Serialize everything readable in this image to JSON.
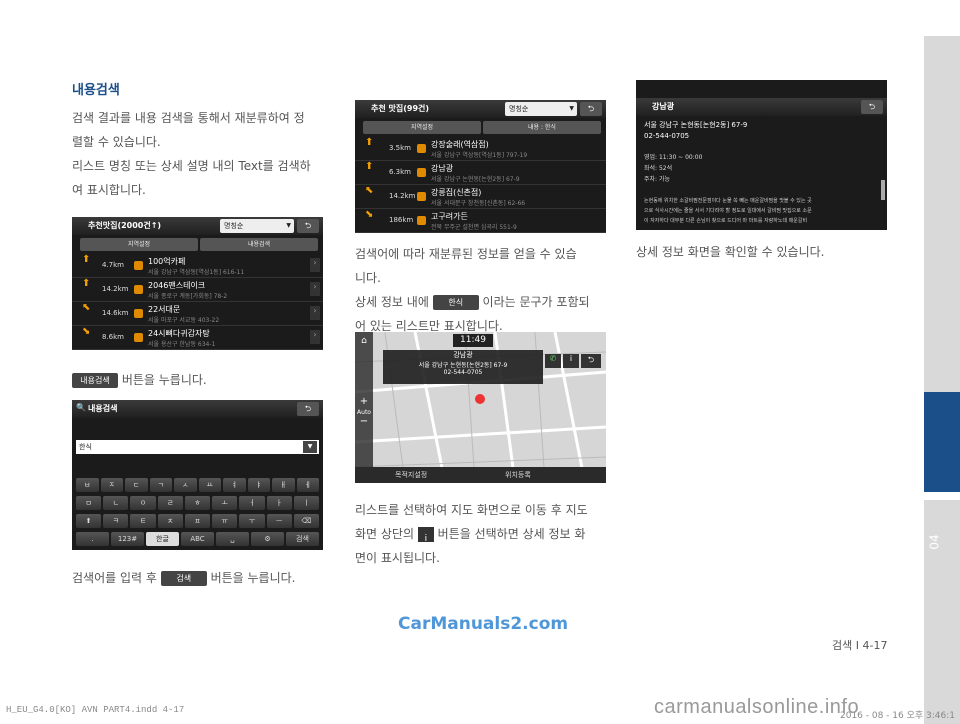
{
  "heading": "내용검색",
  "intro": [
    "검색 결과를 내용 검색을 통해서 재분류하여 정",
    "렬할 수 있습니다.",
    "리스트 명칭 또는 상세 설명 내의 Text를 검색하",
    "여 표시합니다."
  ],
  "shot1": {
    "title": "추천맛집(2000건↑)",
    "sort": "명칭순",
    "btn_area": "지역설정",
    "btn_search": "내용검색",
    "rows": [
      {
        "dist": "4.7km",
        "name": "100억카페",
        "addr": "서울 강남구 역삼동[역삼1동] 616-11"
      },
      {
        "dist": "14.2km",
        "name": "2046팬스테이크",
        "addr": "서울 종로구 계동[가회동] 78-2"
      },
      {
        "dist": "14.6km",
        "name": "22서대문",
        "addr": "서울 마포구 서교동 403-22"
      },
      {
        "dist": "8.6km",
        "name": "24시뼈다귀감자탕",
        "addr": "서울 용산구 한남동 634-1"
      }
    ]
  },
  "step1": {
    "button": "내용검색",
    "text": "버튼을 누릅니다."
  },
  "shot2": {
    "title": "내용검색",
    "input": "한식",
    "keys_row1": [
      "ㅂ",
      "ㅈ",
      "ㄷ",
      "ㄱ",
      "ㅅ",
      "ㅛ",
      "ㅕ",
      "ㅑ",
      "ㅐ",
      "ㅔ"
    ],
    "keys_row2": [
      "ㅁ",
      "ㄴ",
      "ㅇ",
      "ㄹ",
      "ㅎ",
      "ㅗ",
      "ㅓ",
      "ㅏ",
      "ㅣ"
    ],
    "keys_row3": [
      "⬆",
      "ㅋ",
      "ㅌ",
      "ㅊ",
      "ㅍ",
      "ㅠ",
      "ㅜ",
      "ㅡ",
      "⌫"
    ],
    "keys_row4": [
      ".",
      "123#",
      "한글",
      "ABC",
      "␣",
      "⚙",
      "검색"
    ]
  },
  "step2": {
    "pre": "검색어를 입력 후",
    "button": "검색",
    "text": "버튼을 누릅니다."
  },
  "shot3": {
    "title": "추천 맛집(99건)",
    "sort": "명칭순",
    "btn_area": "지역설정",
    "btn_search": "내용 : 한식",
    "rows": [
      {
        "dist": "3.5km",
        "name": "강장술래(역삼점)",
        "addr": "서울 강남구 역삼동[역삼1동] 797-19"
      },
      {
        "dist": "6.3km",
        "name": "강남광",
        "addr": "서울 강남구 논현동[논현2동] 67-9"
      },
      {
        "dist": "14.2km",
        "name": "강릉집(신촌점)",
        "addr": "서울 서대문구 창천동[신촌동] 62-66"
      },
      {
        "dist": "186km",
        "name": "고구려가든",
        "addr": "전북 무주군 설천면 심곡리 551-9"
      }
    ]
  },
  "mid_text": [
    "검색어에 따라 재분류된 정보를 얻을 수 있습",
    "니다.",
    "상세 정보 내에",
    "이라는 문구가 포함되",
    "어 있는 리스트만 표시합니다."
  ],
  "mid_btn": "한식",
  "shot4": {
    "time": "11:49",
    "name": "강남광",
    "addr": "서울 강남구 논현동[논현2동] 67-9",
    "phone": "02-544-0705",
    "btn_dest": "목적지설정",
    "btn_reg": "위치등록",
    "zoom": "Auto"
  },
  "mid_text2": [
    "리스트를 선택하여 지도 화면으로 이동 후 지도",
    "화면 상단의",
    "버튼을 선택하면 상세 정보 화",
    "면이 표시됩니다."
  ],
  "shot5": {
    "title": "강남광",
    "addr": "서울 강남구 논현동[논현2동] 67-9",
    "phone": "02-544-0705",
    "hours": "영업: 11:30 ~ 00:00",
    "seats": "좌석: 52석",
    "parking": "주차: 가능",
    "desc": [
      "논현동에 위치한 소갈비찜전문점이다 눈물 쏙 빼는 매운갈비찜을 맛볼 수 있는 곳",
      "으로 식사시간에는 줄을 서서 기다려야 할 정도로 일대에서 갈비찜 맛집으로 소문",
      "이 자자하다 대부분 다른 손님이 찾으로 드디어 마 마트를 자랑하노데 매운갈비"
    ]
  },
  "right_text": "상세 정보 화면을 확인할 수 있습니다.",
  "watermark": "CarManuals2.com",
  "page_footer": "검색 I 4-17",
  "side_tab": "04",
  "bottom_left": "H_EU_G4.0[KO] AVN PART4.indd   4-17",
  "bottom_right": "2016 - 08 - 16   오후 3:46:1",
  "bottom_logo": "carmanualsonline.info"
}
